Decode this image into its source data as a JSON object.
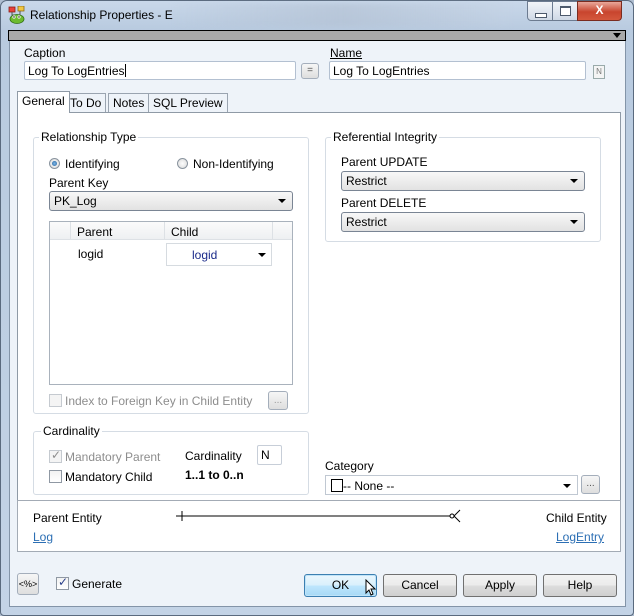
{
  "window": {
    "title": "Relationship Properties - E",
    "controls": [
      "minimize",
      "maximize",
      "close"
    ],
    "close_glyph": "X"
  },
  "header": {
    "caption_label": "Caption",
    "caption_value": "Log To LogEntries",
    "equals_button": "=",
    "name_label": "Name",
    "name_value": "Log To LogEntries",
    "name_icon_glyph": "N"
  },
  "tabs": [
    {
      "label": "General",
      "active": true
    },
    {
      "label": "To Do",
      "active": false
    },
    {
      "label": "Notes",
      "active": false
    },
    {
      "label": "SQL Preview",
      "active": false
    }
  ],
  "relationship_type": {
    "title": "Relationship Type",
    "options": [
      {
        "label": "Identifying",
        "selected": true
      },
      {
        "label": "Non-Identifying",
        "selected": false
      }
    ],
    "parent_key_label": "Parent Key",
    "parent_key_value": "PK_Log",
    "grid": {
      "columns": [
        "Parent",
        "Child"
      ],
      "rows": [
        {
          "parent": "logid",
          "child": "logid"
        }
      ]
    },
    "index_fk_label": "Index to Foreign Key in Child Entity",
    "index_fk_checked": false,
    "ellipsis_button": "..."
  },
  "referential_integrity": {
    "title": "Referential Integrity",
    "parent_update_label": "Parent UPDATE",
    "parent_update_value": "Restrict",
    "parent_delete_label": "Parent DELETE",
    "parent_delete_value": "Restrict"
  },
  "cardinality": {
    "title": "Cardinality",
    "mandatory_parent_label": "Mandatory Parent",
    "mandatory_parent_checked": true,
    "mandatory_child_label": "Mandatory Child",
    "mandatory_child_checked": false,
    "cardinality_label": "Cardinality",
    "cardinality_value": "N",
    "summary": "1..1 to 0..n"
  },
  "category": {
    "label": "Category",
    "value": "-- None --",
    "ellipsis_button": "..."
  },
  "entities": {
    "parent_label": "Parent Entity",
    "parent_link": "Log",
    "child_label": "Child Entity",
    "child_link": "LogEntry"
  },
  "footer": {
    "macro_button": "<%>",
    "generate_label": "Generate",
    "generate_checked": true,
    "buttons": {
      "ok": "OK",
      "cancel": "Cancel",
      "apply": "Apply",
      "help": "Help"
    }
  }
}
